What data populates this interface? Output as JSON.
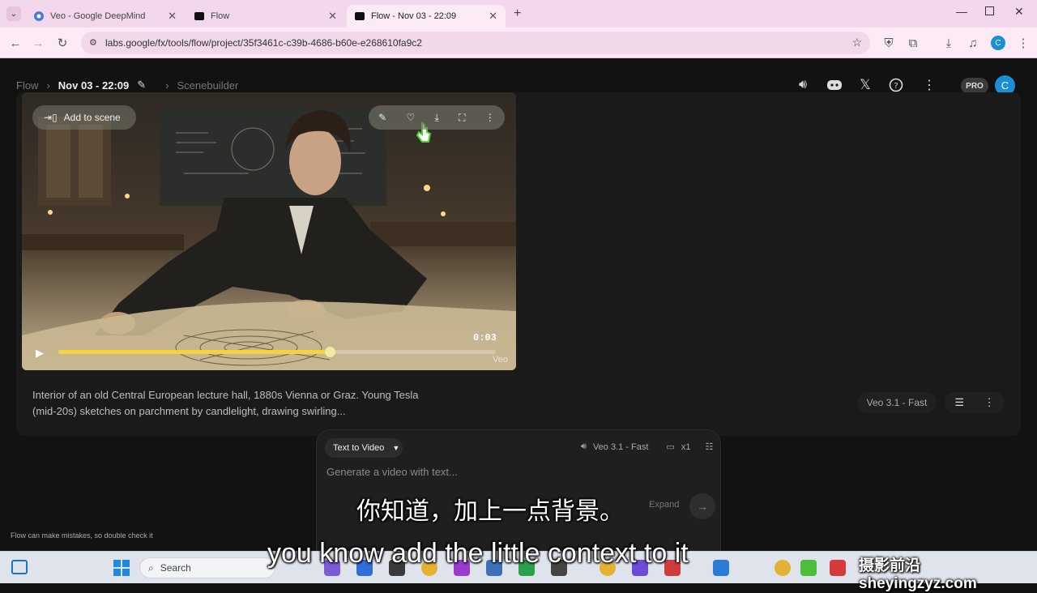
{
  "browser": {
    "tabs": [
      {
        "title": "Veo - Google DeepMind",
        "active": false
      },
      {
        "title": "Flow",
        "active": false
      },
      {
        "title": "Flow - Nov 03 - 22:09",
        "active": true
      }
    ],
    "url": "labs.google/fx/tools/flow/project/35f3461c-c39b-4686-b60e-e268610fa9c2",
    "profile_initial": "C"
  },
  "app": {
    "breadcrumb": [
      "Flow",
      "Nov 03 - 22:09",
      "Scenebuilder"
    ],
    "pro_badge": "PRO",
    "avatar_initial": "C",
    "clip": {
      "add_to_scene": "Add to scene",
      "time": "0:03",
      "watermark": "Veo",
      "progress": 0.62,
      "prompt": "Interior of an old Central European lecture hall, 1880s Vienna or Graz. Young Tesla (mid-20s) sketches on parchment by candlelight, drawing swirling...",
      "model": "Veo 3.1 - Fast"
    },
    "composer": {
      "mode": "Text to Video",
      "model": "Veo 3.1 - Fast",
      "count": "x1",
      "placeholder": "Generate a video with text...",
      "expand": "Expand"
    },
    "disclaimer": "Flow can make mistakes, so double check it"
  },
  "subtitles": {
    "zh": "你知道，加上一点背景。",
    "en": "you know add the little context to it",
    "watermark": "摄影前沿 sheyingzyz.com"
  },
  "taskbar": {
    "search_placeholder": "Search"
  },
  "colors": {
    "accent_progress": "#f3d43b",
    "avatar": "#1a8fd6",
    "browser_frame": "#f3d7ec"
  }
}
